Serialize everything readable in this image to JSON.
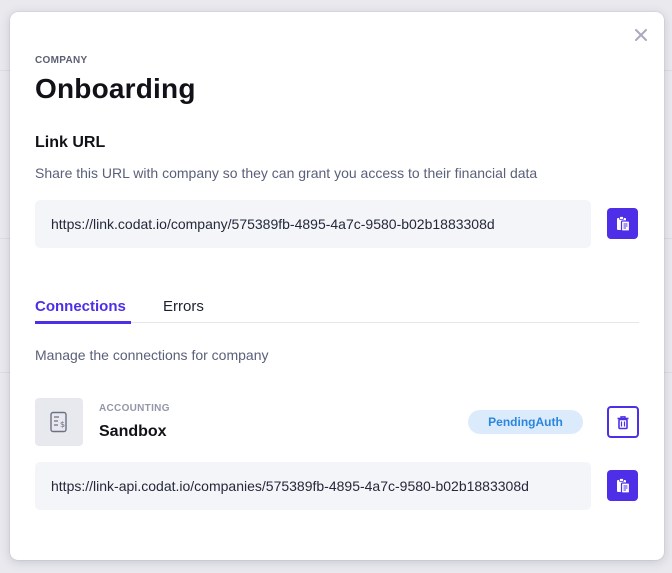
{
  "modal": {
    "eyebrow": "COMPANY",
    "title": "Onboarding",
    "close_icon": "close-icon"
  },
  "link_url": {
    "heading": "Link URL",
    "description": "Share this URL with company so they can grant you access to their financial data",
    "url": "https://link.codat.io/company/575389fb-4895-4a7c-9580-b02b1883308d",
    "copy_icon": "copy-clipboard-icon"
  },
  "tabs": [
    {
      "label": "Connections",
      "active": true
    },
    {
      "label": "Errors",
      "active": false
    }
  ],
  "connections": {
    "description": "Manage the connections for company",
    "items": [
      {
        "type": "ACCOUNTING",
        "name": "Sandbox",
        "status": "PendingAuth",
        "url": "https://link-api.codat.io/companies/575389fb-4895-4a7c-9580-b02b1883308d",
        "icon": "accounting-document-icon",
        "delete_icon": "trash-icon"
      }
    ]
  },
  "colors": {
    "accent": "#4f2ee8",
    "badge_bg": "#dcebfb",
    "badge_text": "#2a86de"
  }
}
